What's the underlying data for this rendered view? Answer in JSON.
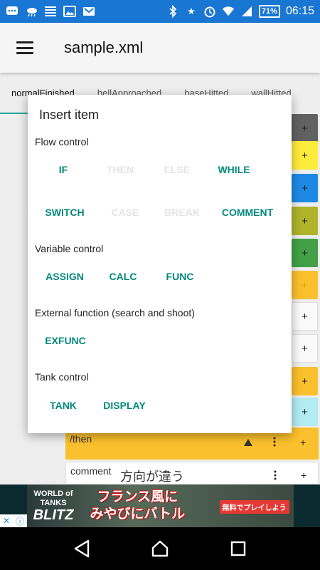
{
  "status_bar": {
    "battery": "71%",
    "time": "06:15"
  },
  "app_bar": {
    "title": "sample.xml"
  },
  "tabs": [
    {
      "label": "normalFinished"
    },
    {
      "label": "hellApproached"
    },
    {
      "label": "baseHitted"
    },
    {
      "label": "wallHitted"
    }
  ],
  "background_rows": {
    "then_label": "/then",
    "comment_label": "comment",
    "comment_value": "方向が違う"
  },
  "dialog": {
    "title": "Insert item",
    "sections": {
      "flow": "Flow control",
      "variable": "Variable control",
      "external": "External function (search and shoot)",
      "tank": "Tank control"
    },
    "buttons": {
      "if": "IF",
      "then": "THEN",
      "else": "ELSE",
      "while": "WHILE",
      "switch": "SWITCH",
      "case": "CASE",
      "break": "BREAK",
      "comment": "COMMENT",
      "assign": "ASSIGN",
      "calc": "CALC",
      "func": "FUNC",
      "exfunc": "EXFUNC",
      "tank": "TANK",
      "display": "DISPLAY"
    }
  },
  "ad": {
    "logo_top": "WORLD of TANKS",
    "logo_bottom": "BLITZ",
    "headline_1": "フランス風に",
    "headline_2": "みやびにバトル",
    "cta": "無料でプレイしよう"
  },
  "plus_symbol": "+",
  "colors": {
    "status_bar": "#1976d2",
    "accent": "#00897b",
    "tab_indicator": "#26a69a",
    "strip_dark": "#616161",
    "strip_yellow": "#ffeb3b",
    "strip_blue": "#1e88e5",
    "strip_olive": "#afb42b",
    "strip_green": "#43a047",
    "strip_amber": "#fbc02d",
    "strip_white": "#fafafa",
    "strip_cyan": "#b2ebf2"
  }
}
